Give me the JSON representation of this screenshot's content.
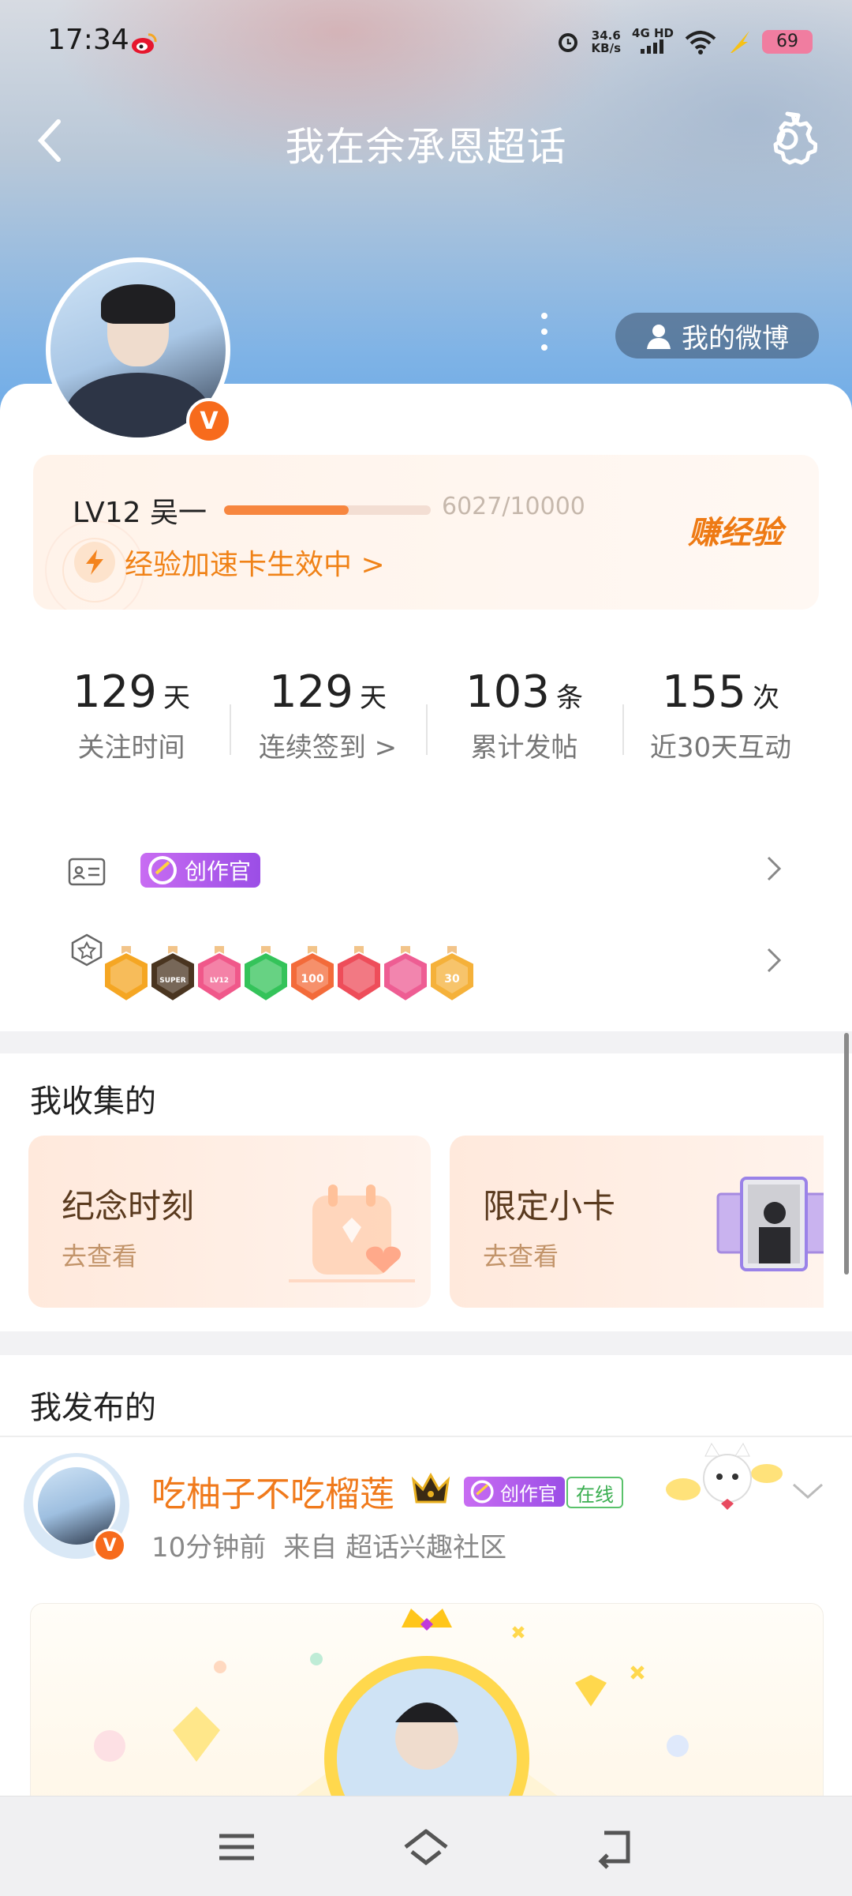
{
  "status_bar": {
    "time": "17:34",
    "net_speed": "34.6",
    "net_unit": "KB/s",
    "network": "4G HD",
    "battery": "69"
  },
  "header": {
    "title": "我在余承恩超话"
  },
  "profile": {
    "my_weibo_label": "我的微博",
    "verified_mark": "V"
  },
  "level": {
    "label": "LV12 吴一",
    "progress_text": "6027/10000",
    "progress_fraction": 0.6027,
    "boost_text": "经验加速卡生效中 >",
    "earn_label": "赚经验"
  },
  "stats": [
    {
      "value": "129",
      "unit": "天",
      "label": "关注时间"
    },
    {
      "value": "129",
      "unit": "天",
      "label": "连续签到 >"
    },
    {
      "value": "103",
      "unit": "条",
      "label": "累计发帖"
    },
    {
      "value": "155",
      "unit": "次",
      "label": "近30天互动"
    }
  ],
  "badges": {
    "creator_label": "创作官",
    "medals": [
      {
        "name": "crown-medal",
        "color": "#f5a623"
      },
      {
        "name": "super-medal",
        "color": "#4a3520",
        "text": "SUPER"
      },
      {
        "name": "lv12-medal",
        "color": "#f0588a",
        "text": "LV12"
      },
      {
        "name": "hand-medal",
        "color": "#34c35a"
      },
      {
        "name": "100-days-medal",
        "color": "#f36b3a",
        "text": "100"
      },
      {
        "name": "trophy-medal",
        "color": "#ee4d5a"
      },
      {
        "name": "cap-medal",
        "color": "#ee5d93"
      },
      {
        "name": "30-days-medal",
        "color": "#f5b13a",
        "text": "30"
      }
    ]
  },
  "collected": {
    "title": "我收集的",
    "cards": [
      {
        "title": "纪念时刻",
        "sub": "去查看"
      },
      {
        "title": "限定小卡",
        "sub": "去查看"
      }
    ]
  },
  "published": {
    "title": "我发布的",
    "post": {
      "author": "吃柚子不吃榴莲",
      "creator_label": "创作官",
      "online_label": "在线",
      "time": "10分钟前",
      "source": "来自 超话兴趣社区"
    }
  }
}
